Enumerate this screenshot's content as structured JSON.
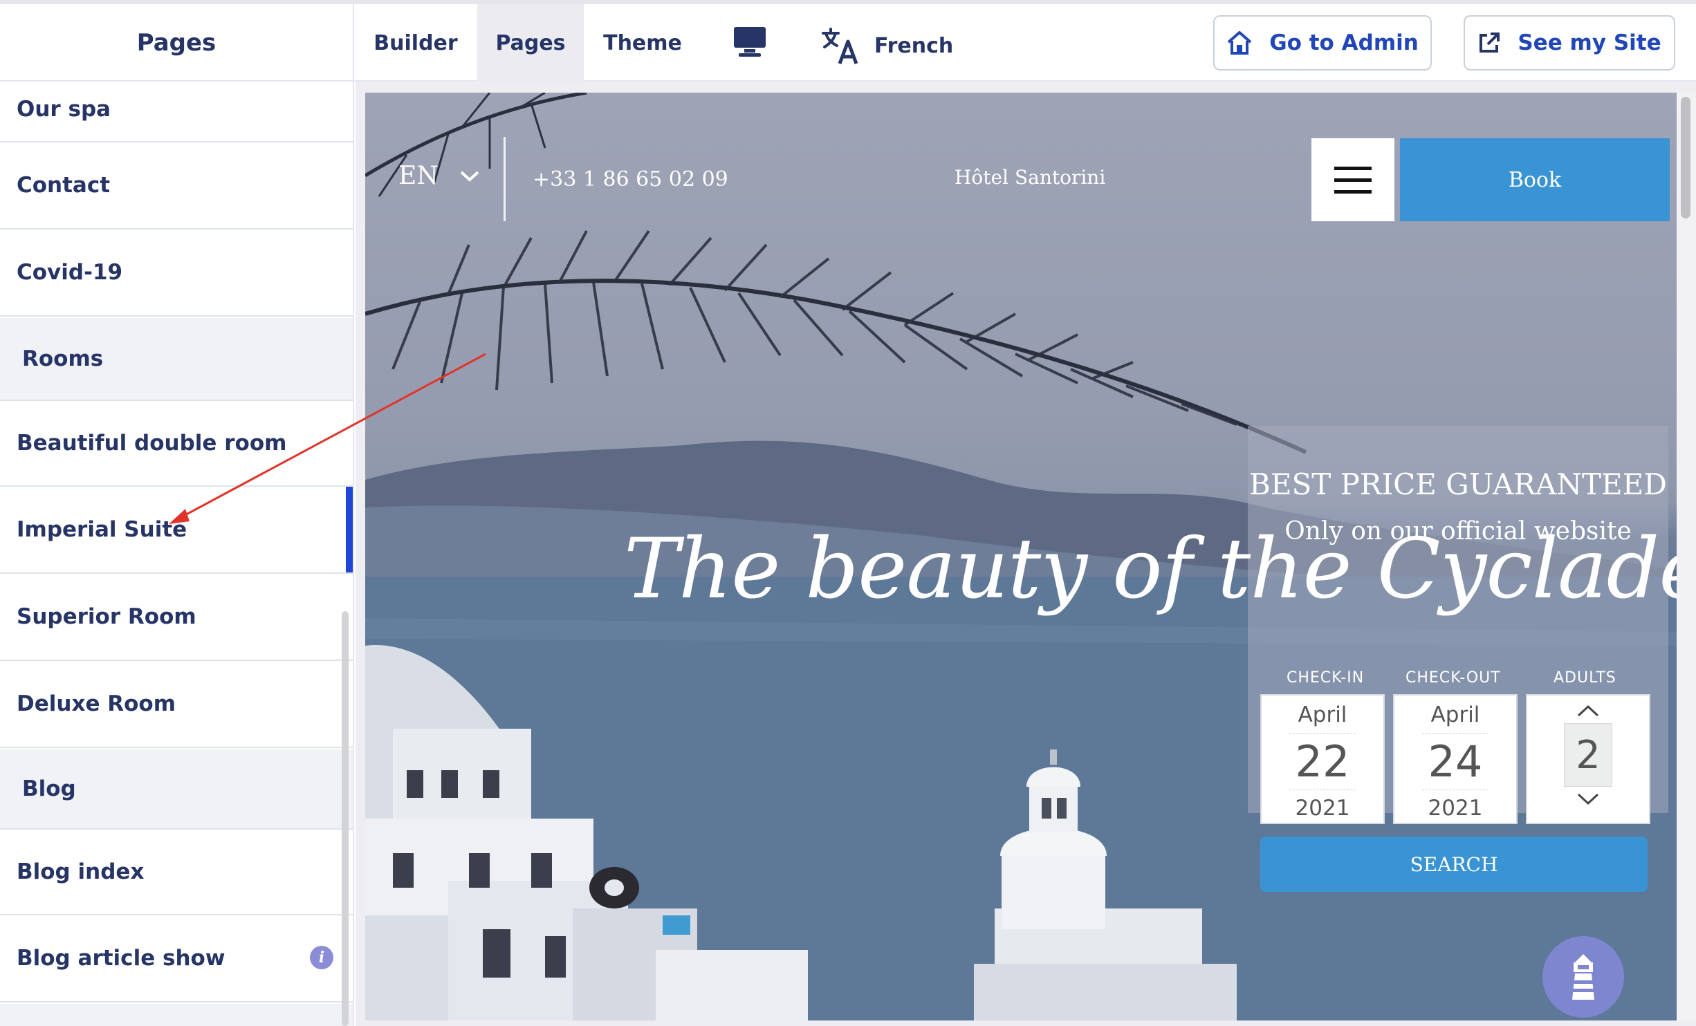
{
  "sidebar": {
    "title": "Pages",
    "items": [
      {
        "label": "Our spa"
      },
      {
        "label": "Contact"
      },
      {
        "label": "Covid-19"
      },
      {
        "group": "Rooms"
      },
      {
        "label": "Beautiful double room"
      },
      {
        "label": "Imperial Suite",
        "active": true
      },
      {
        "label": "Superior Room"
      },
      {
        "label": "Deluxe Room"
      },
      {
        "group": "Blog"
      },
      {
        "label": "Blog index"
      },
      {
        "label": "Blog article show",
        "info_icon": "i"
      }
    ]
  },
  "toolbar": {
    "tabs": [
      {
        "label": "Builder"
      },
      {
        "label": "Pages",
        "active": true
      },
      {
        "label": "Theme"
      }
    ],
    "device_icon": "desktop-icon",
    "language_label": "French",
    "admin_button": "Go to Admin",
    "site_button": "See my Site"
  },
  "preview": {
    "language": "EN",
    "phone": "+33 1 86 65 02 09",
    "hotel_name": "Hôtel Santorini",
    "book_label": "Book",
    "headline": "The beauty of the Cyclades",
    "booking": {
      "title": "BEST PRICE GUARANTEED",
      "subtitle": "Only on our official website",
      "checkin_label": "CHECK-IN",
      "checkout_label": "CHECK-OUT",
      "adults_label": "ADULTS",
      "checkin": {
        "month": "April",
        "day": "22",
        "year": "2021"
      },
      "checkout": {
        "month": "April",
        "day": "24",
        "year": "2021"
      },
      "adults": "2",
      "search_label": "SEARCH"
    }
  },
  "colors": {
    "accent_nav": "#1f46d6",
    "brand_text": "#263466",
    "book_blue": "#3a93d3",
    "annotation_arrow": "#e0342a"
  }
}
